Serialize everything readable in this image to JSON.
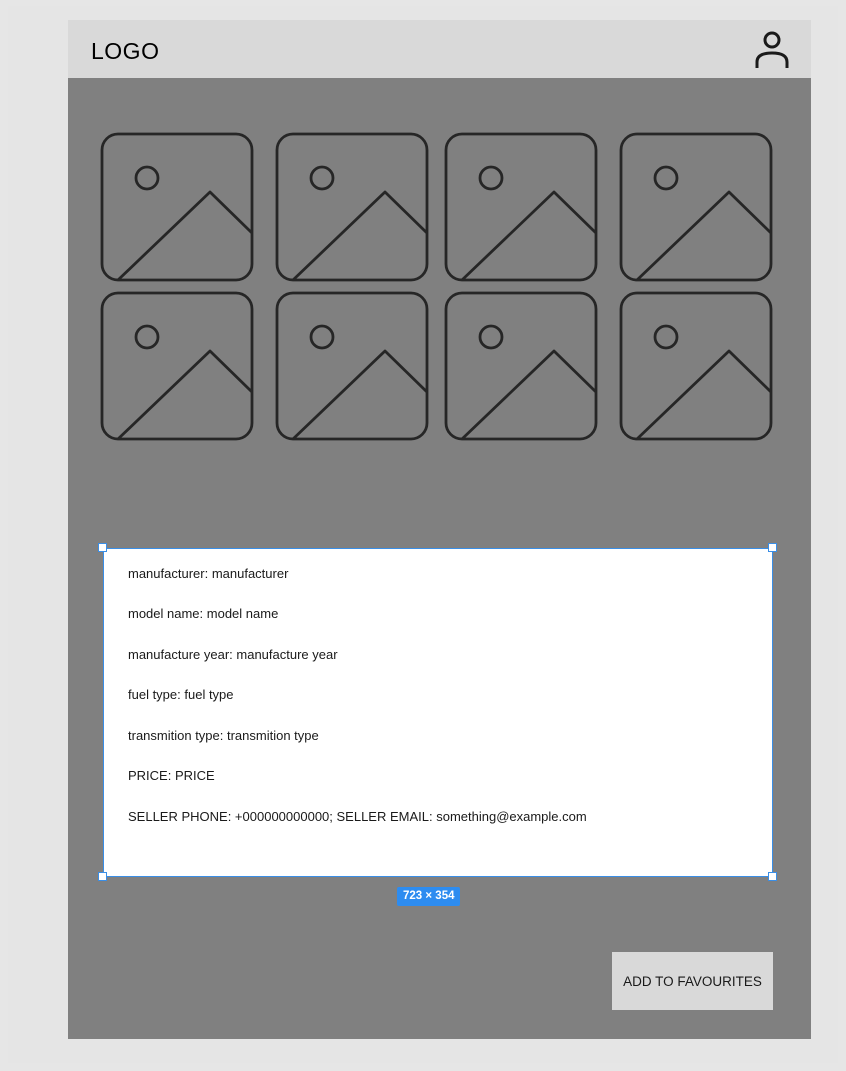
{
  "header": {
    "logo": "LOGO",
    "profile_icon": "user-icon"
  },
  "gallery": {
    "image_icon": "image-placeholder-icon",
    "count": 8
  },
  "details": {
    "manufacturer": "manufacturer: manufacturer",
    "model_name": "model name: model name",
    "manufacture_year": "manufacture year: manufacture year",
    "fuel_type": "fuel type: fuel type",
    "transmission_type": "transmition type: transmition type",
    "price": "PRICE: PRICE",
    "seller_contact": "SELLER PHONE: +000000000000; SELLER EMAIL: something@example.com"
  },
  "selection": {
    "size_label": "723 × 354"
  },
  "actions": {
    "add_to_favourites": "ADD TO FAVOURITES"
  },
  "colors": {
    "frame_bg": "#808080",
    "header_bg": "#d9d9d9",
    "selection_accent": "#2d8cf0"
  }
}
